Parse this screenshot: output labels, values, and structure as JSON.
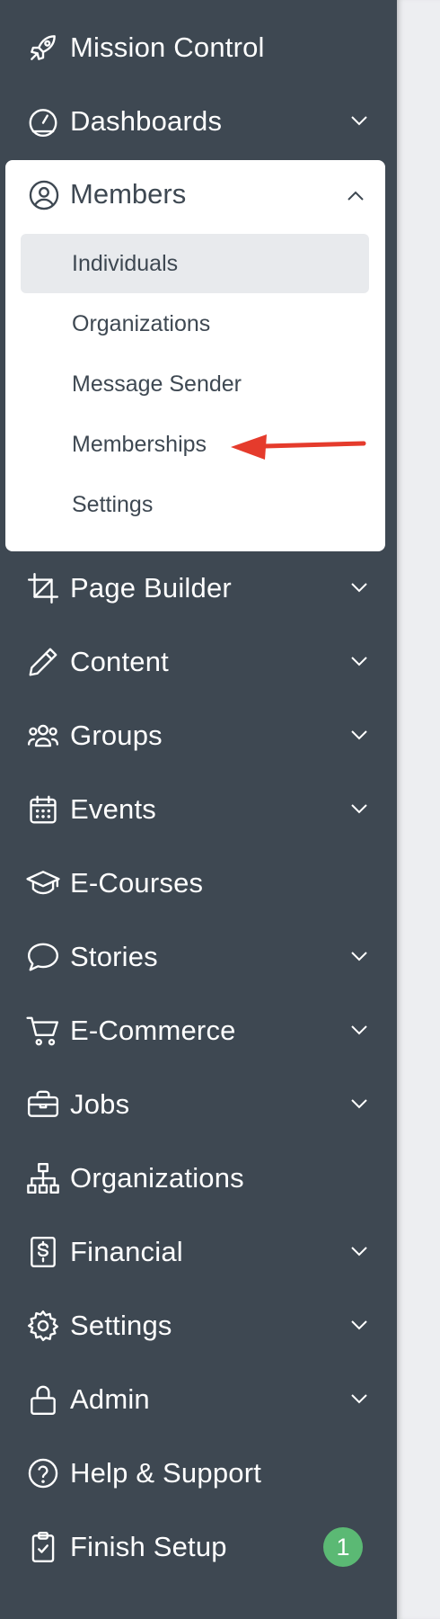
{
  "sidebar": {
    "items": [
      {
        "label": "Mission Control",
        "icon": "rocket-icon",
        "has_chevron": false
      },
      {
        "label": "Dashboards",
        "icon": "gauge-icon",
        "has_chevron": true
      },
      {
        "label": "Page Builder",
        "icon": "crop-icon",
        "has_chevron": true
      },
      {
        "label": "Content",
        "icon": "pencil-icon",
        "has_chevron": true
      },
      {
        "label": "Groups",
        "icon": "users-icon",
        "has_chevron": true
      },
      {
        "label": "Events",
        "icon": "calendar-icon",
        "has_chevron": true
      },
      {
        "label": "E-Courses",
        "icon": "graduation-cap-icon",
        "has_chevron": false
      },
      {
        "label": "Stories",
        "icon": "speech-bubble-icon",
        "has_chevron": true
      },
      {
        "label": "E-Commerce",
        "icon": "cart-icon",
        "has_chevron": true
      },
      {
        "label": "Jobs",
        "icon": "briefcase-icon",
        "has_chevron": true
      },
      {
        "label": "Organizations",
        "icon": "org-chart-icon",
        "has_chevron": false
      },
      {
        "label": "Financial",
        "icon": "dollar-doc-icon",
        "has_chevron": true
      },
      {
        "label": "Settings",
        "icon": "gear-icon",
        "has_chevron": true
      },
      {
        "label": "Admin",
        "icon": "lock-icon",
        "has_chevron": true
      },
      {
        "label": "Help & Support",
        "icon": "help-circle-icon",
        "has_chevron": false
      },
      {
        "label": "Finish Setup",
        "icon": "clipboard-check-icon",
        "has_chevron": false,
        "badge": "1"
      }
    ],
    "members": {
      "label": "Members",
      "icon": "user-circle-icon",
      "expanded": true,
      "subitems": [
        {
          "label": "Individuals",
          "active": true
        },
        {
          "label": "Organizations",
          "active": false
        },
        {
          "label": "Message Sender",
          "active": false
        },
        {
          "label": "Memberships",
          "active": false
        },
        {
          "label": "Settings",
          "active": false
        }
      ]
    }
  },
  "colors": {
    "sidebar_bg": "#3e4852",
    "panel_bg": "#ffffff",
    "active_bg": "#e8eaed",
    "badge_green": "#5bb974",
    "arrow_red": "#e53b2c",
    "content_bg": "#edeef1"
  },
  "annotation": {
    "type": "red-arrow",
    "points_to": "Memberships"
  }
}
